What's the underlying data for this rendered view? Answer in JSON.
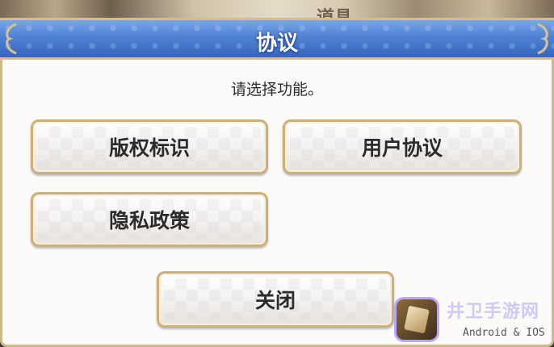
{
  "background": {
    "label": "道具"
  },
  "dialog": {
    "title": "协议",
    "prompt": "请选择功能。",
    "buttons": {
      "copyright": "版权标识",
      "user_agreement": "用户协议",
      "privacy_policy": "隐私政策",
      "close": "关闭"
    }
  },
  "watermark": {
    "site": "井卫手游网",
    "platform": "Android & IOS"
  },
  "colors": {
    "title_bar": "#4f81d3",
    "border": "#cbb07a",
    "dialog_bg": "#fbfaf8"
  }
}
